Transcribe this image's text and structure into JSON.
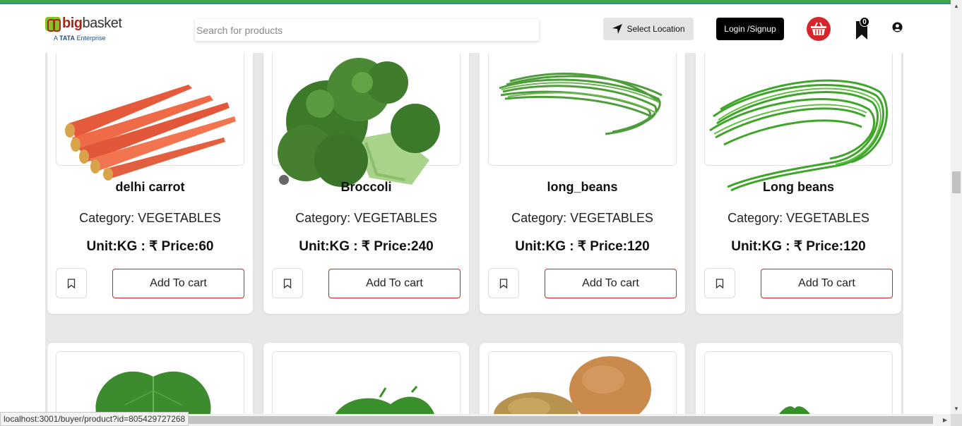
{
  "header": {
    "brand_name_bold": "bb",
    "brand_name": "basket",
    "brand_prefix": "big",
    "brand_sub_prefix": "A ",
    "brand_sub_bold": "TATA",
    "brand_sub_rest": " Enterprise",
    "search_placeholder": "Search for products",
    "select_location": "Select Location",
    "login": "Login /Signup",
    "bookmark_count": "0"
  },
  "products": [
    {
      "name": "delhi carrot",
      "category": "Category: VEGETABLES",
      "unit_price": "Unit:KG : ₹ Price:60",
      "add_to_cart": "Add To cart"
    },
    {
      "name": "Broccoli",
      "category": "Category: VEGETABLES",
      "unit_price": "Unit:KG : ₹ Price:240",
      "add_to_cart": "Add To cart"
    },
    {
      "name": "long_beans",
      "category": "Category: VEGETABLES",
      "unit_price": "Unit:KG : ₹ Price:120",
      "add_to_cart": "Add To cart"
    },
    {
      "name": "Long beans",
      "category": "Category: VEGETABLES",
      "unit_price": "Unit:KG : ₹ Price:120",
      "add_to_cart": "Add To cart"
    }
  ],
  "status_bar": {
    "url": "localhost:3001/buyer/product?id=805429727268"
  },
  "colors": {
    "accent_green": "#3da848",
    "cart_border": "#c62828",
    "basket_red": "#d6252b"
  }
}
